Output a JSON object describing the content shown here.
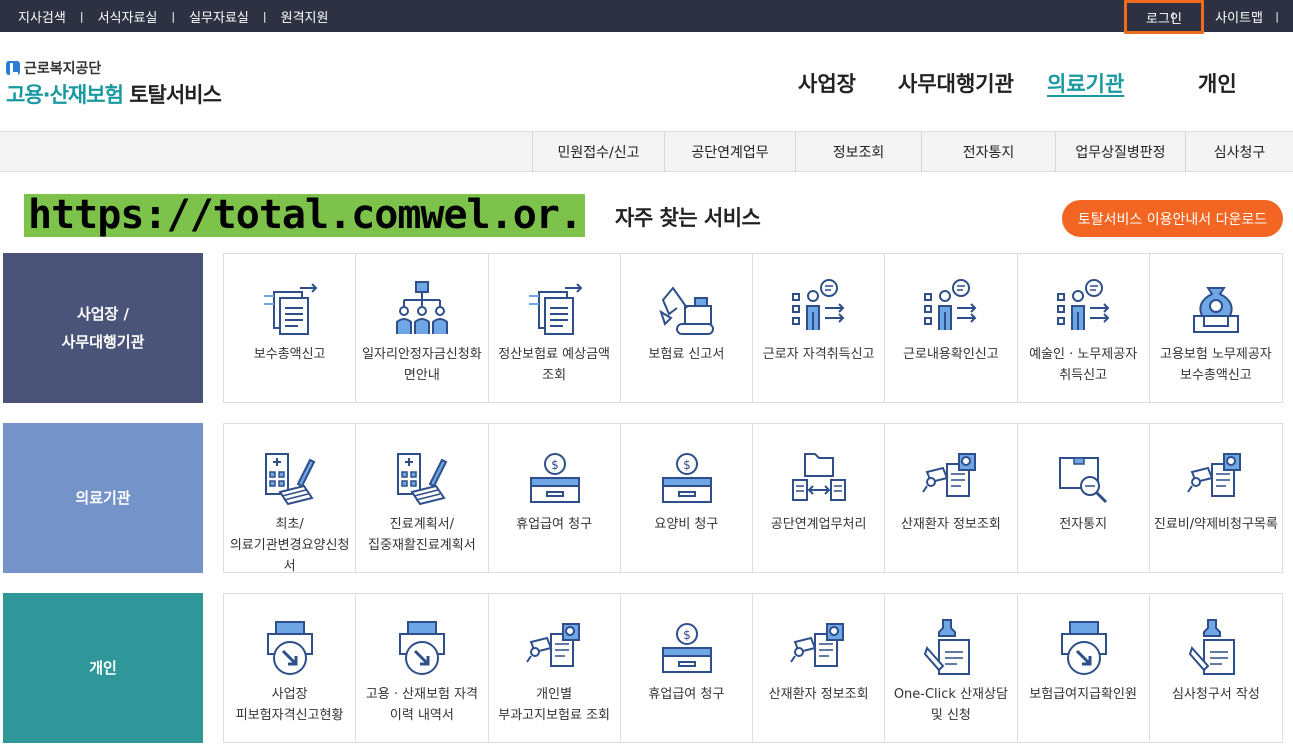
{
  "topbar": {
    "left": [
      "지사검색",
      "서식자료실",
      "실무자료실",
      "원격지원"
    ],
    "login": "로그인",
    "sitemap": "사이트맵"
  },
  "logo": {
    "org": "근로복지공단",
    "title_teal": "고용·산재보험",
    "title_dark": "토탈서비스"
  },
  "mainnav": [
    "사업장",
    "사무대행기관",
    "의료기관",
    "개인"
  ],
  "mainnav_active": "의료기관",
  "subnav": [
    "민원접수/신고",
    "공단연계업무",
    "정보조회",
    "전자통지",
    "업무상질병판정",
    "심사청구"
  ],
  "banner_url": "https://total.comwel.or.kr",
  "frequent_title": "자주 찾는 서비스",
  "download_button": "토탈서비스 이용안내서 다운로드",
  "colors": {
    "topbar": "#2d3142",
    "accent": "#1a9aa0",
    "orange": "#f26522",
    "icon": "#2f4f8a"
  },
  "sections": [
    {
      "category": "사업장 /\n사무대행기관",
      "color": "#4a5378",
      "items": [
        {
          "label": "보수총액신고",
          "icon": "document-arrows-icon"
        },
        {
          "label": "일자리안정자금신청화면안내",
          "icon": "people-network-icon"
        },
        {
          "label": "정산보험료 예상금액 조회",
          "icon": "document-arrows-icon"
        },
        {
          "label": "보험료 신고서",
          "icon": "excavator-icon"
        },
        {
          "label": "근로자 자격취득신고",
          "icon": "person-checklist-icon"
        },
        {
          "label": "근로내용확인신고",
          "icon": "person-checklist-icon"
        },
        {
          "label": "예술인 · 노무제공자 취득신고",
          "icon": "person-checklist-icon"
        },
        {
          "label": "고용보험 노무제공자 보수총액신고",
          "icon": "money-bag-icon"
        }
      ]
    },
    {
      "category": "의료기관",
      "color": "#7393c9",
      "items": [
        {
          "label": "최초/의료기관변경요양신청서",
          "icon": "hospital-form-icon"
        },
        {
          "label": "진료계획서/집중재활진료계획서",
          "icon": "hospital-form-icon"
        },
        {
          "label": "휴업급여 청구",
          "icon": "coin-box-icon"
        },
        {
          "label": "요양비 청구",
          "icon": "coin-box-icon"
        },
        {
          "label": "공단연계업무처리",
          "icon": "folder-exchange-icon"
        },
        {
          "label": "산재환자 정보조회",
          "icon": "document-search-icon"
        },
        {
          "label": "전자통지",
          "icon": "mail-search-icon"
        },
        {
          "label": "진료비/약제비청구목록",
          "icon": "document-search-icon"
        }
      ]
    },
    {
      "category": "개인",
      "color": "#2f9699",
      "items": [
        {
          "label": "사업장 피보험자격신고현황",
          "icon": "printer-arrow-icon"
        },
        {
          "label": "고용 · 산재보험 자격 이력 내역서",
          "icon": "printer-arrow-icon"
        },
        {
          "label": "개인별 부과고지보험료 조회",
          "icon": "document-search-icon"
        },
        {
          "label": "휴업급여 청구",
          "icon": "coin-box-icon"
        },
        {
          "label": "산재환자 정보조회",
          "icon": "document-search-icon"
        },
        {
          "label": "One-Click 산재상담 및 신청",
          "icon": "stamp-document-icon"
        },
        {
          "label": "보험급여지급확인원",
          "icon": "printer-arrow-icon"
        },
        {
          "label": "심사청구서 작성",
          "icon": "stamp-document-icon"
        }
      ]
    }
  ]
}
